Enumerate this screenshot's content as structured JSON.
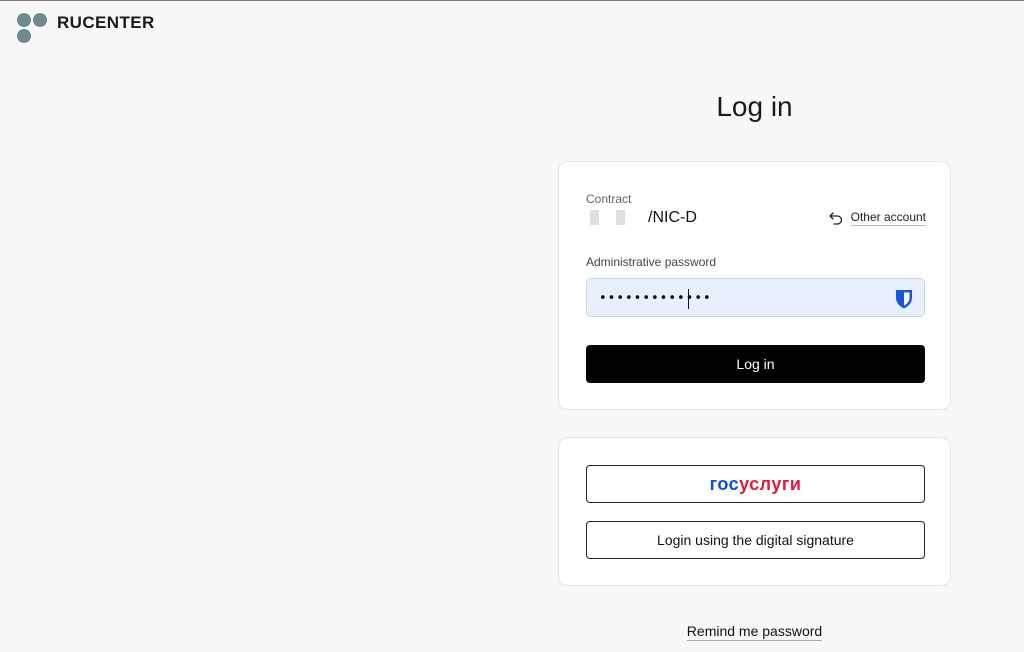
{
  "brand": {
    "name": "RUCENTER",
    "dot_color": "#6d8a90"
  },
  "page_title": "Log in",
  "login_form": {
    "contract_label": "Contract",
    "contract_suffix": "/NIC-D",
    "other_account_label": "Other account",
    "password_label": "Administrative password",
    "password_value": "•••••••••••••",
    "submit_label": "Log in"
  },
  "alt_login": {
    "gosuslugi_part1": "гос",
    "gosuslugi_part2": "услуги",
    "signature_label": "Login using the digital signature"
  },
  "remind_label": "Remind me password",
  "colors": {
    "primary_button": "#000000",
    "password_field_bg": "#e8f0fe",
    "gosuslugi_blue": "#0d4cd3",
    "gosuslugi_red": "#e4183f",
    "password_manager_icon": "#1a56db"
  },
  "icons": {
    "other_account": "undo-arrow-icon",
    "password_field": "shield-icon"
  }
}
